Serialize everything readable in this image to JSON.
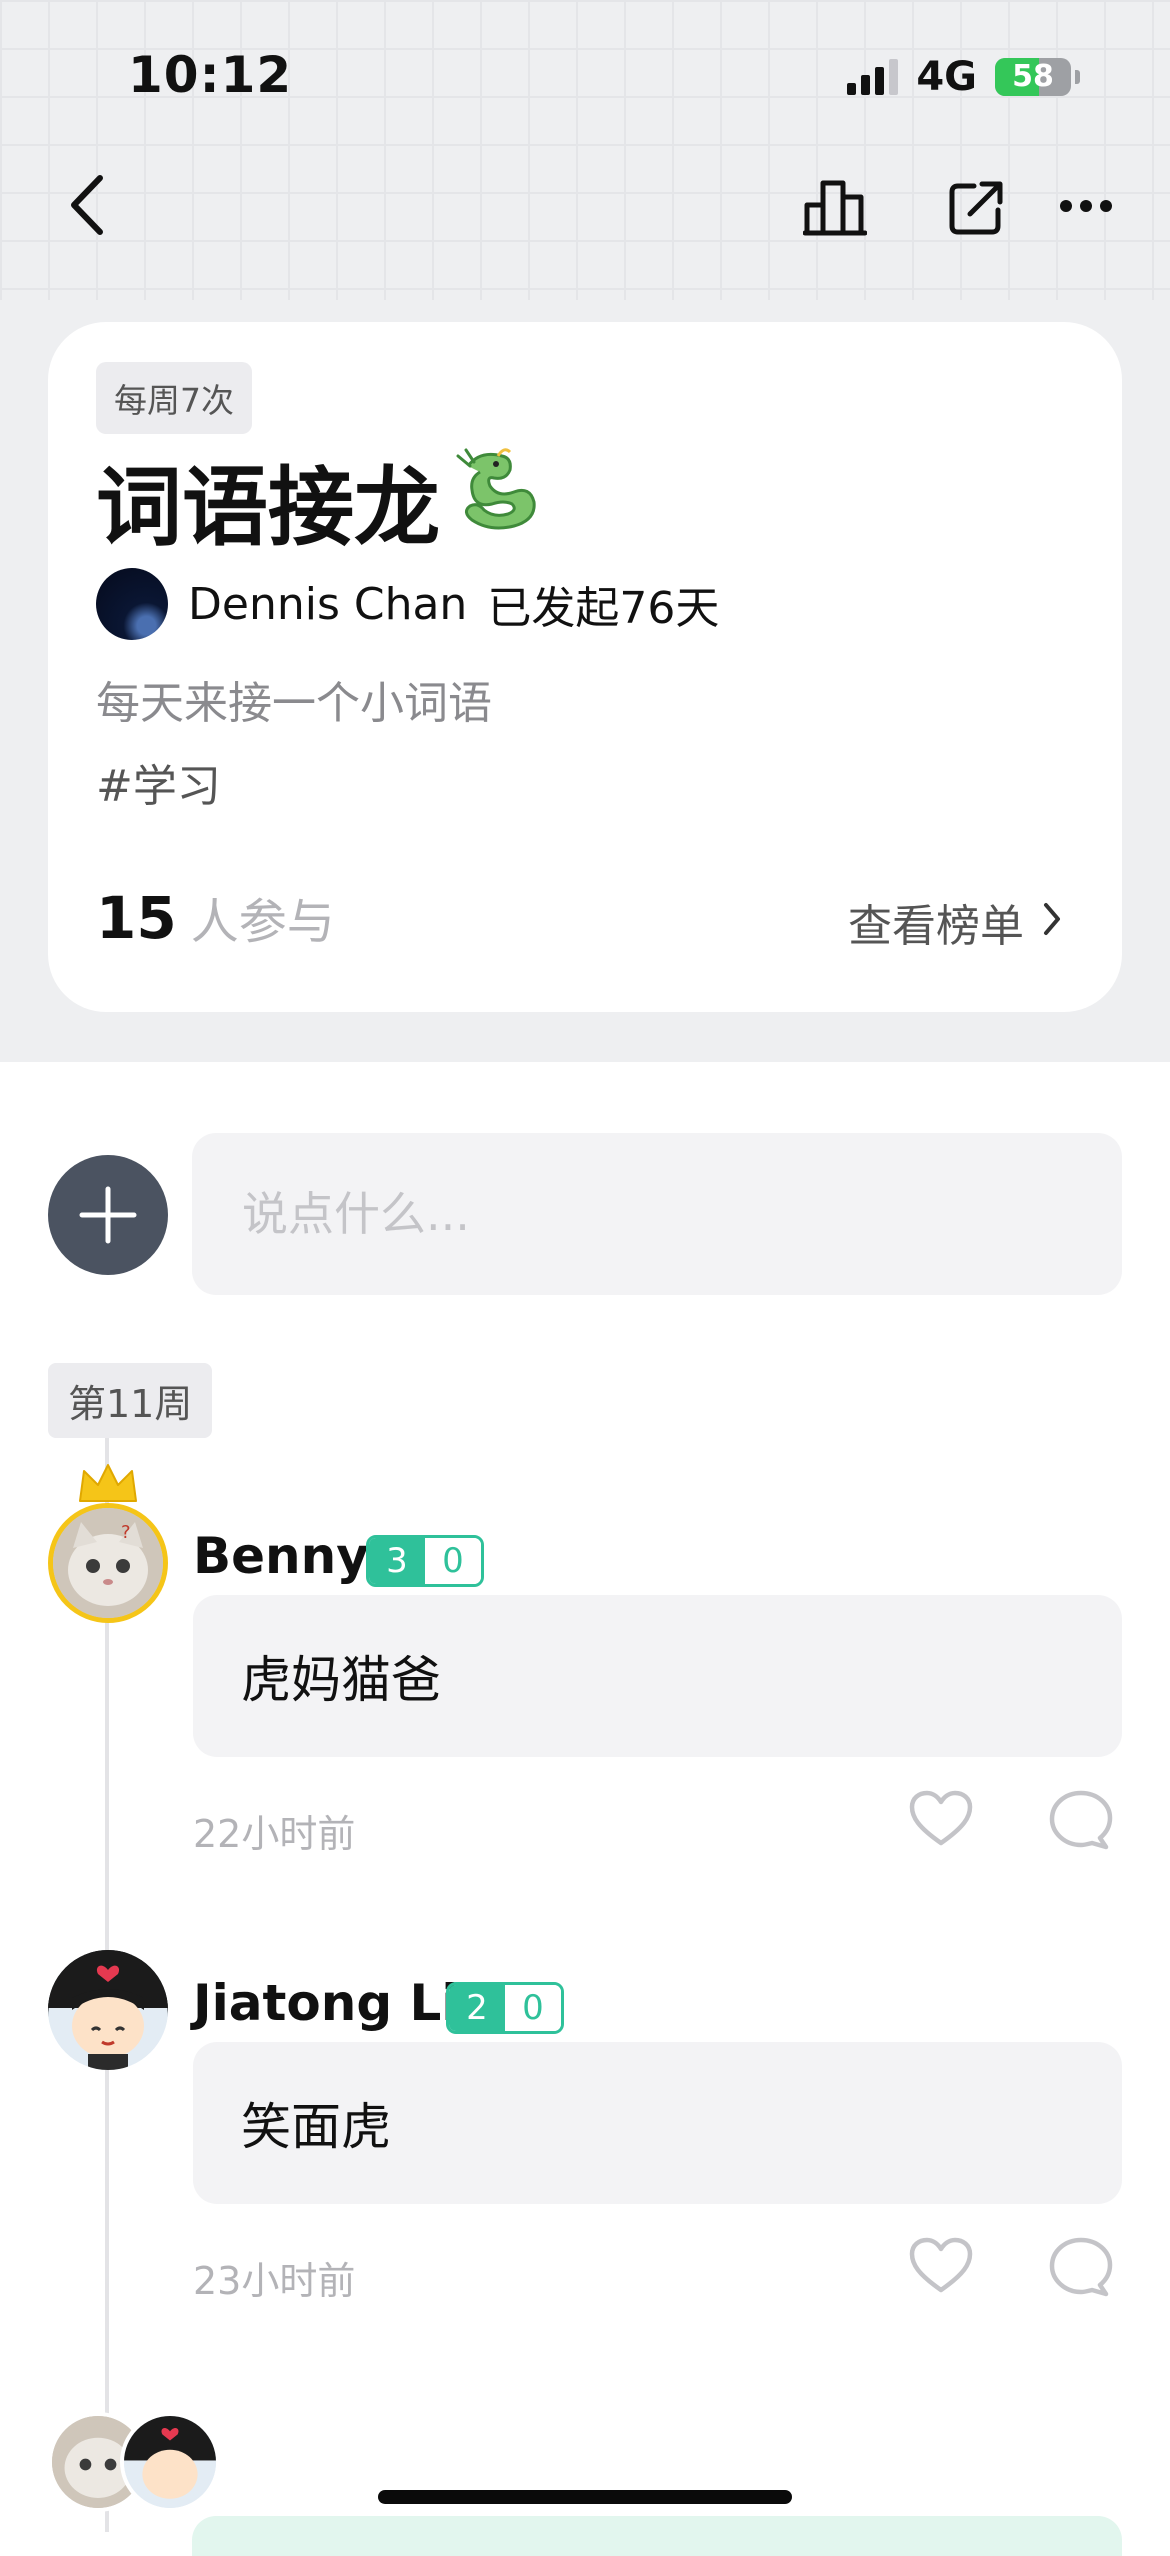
{
  "status_bar": {
    "time": "10:12",
    "network": "4G",
    "battery": "58"
  },
  "card": {
    "frequency": "每周7次",
    "title": "词语接龙",
    "author": "Dennis Chan",
    "days": "已发起76天",
    "description": "每天来接一个小词语",
    "tag": "#学习",
    "participants_count": "15",
    "participants_label": "人参与",
    "leaderboard_label": "查看榜单"
  },
  "compose": {
    "placeholder": "说点什么..."
  },
  "week_label": "第11周",
  "posts": [
    {
      "name": "Benny",
      "score_a": "3",
      "score_b": "0",
      "text": "虎妈猫爸",
      "time": "22小时前"
    },
    {
      "name": "Jiatong Li",
      "score_a": "2",
      "score_b": "0",
      "text": "笑面虎",
      "time": "23小时前"
    }
  ],
  "colors": {
    "accent": "#2fc19a",
    "add_button": "#4b5361",
    "crown": "#f5c518"
  }
}
